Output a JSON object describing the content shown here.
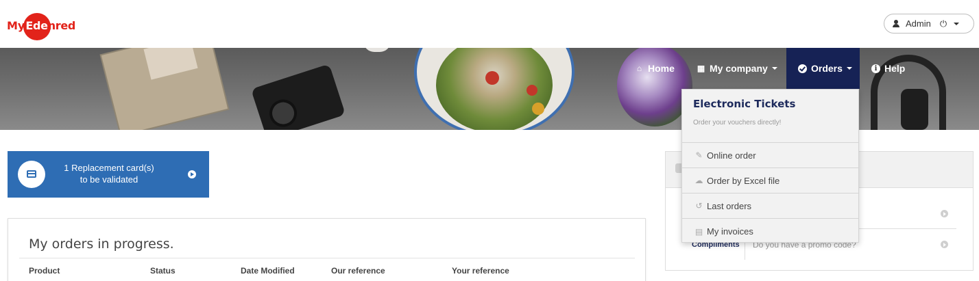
{
  "header": {
    "logo_my": "My",
    "logo_e": "Ede",
    "logo_rest": "nred",
    "admin_label": "Admin",
    "power_icon": "power-icon"
  },
  "nav": {
    "items": [
      {
        "label": "Home",
        "icon": "home-icon"
      },
      {
        "label": "My company",
        "icon": "building-icon"
      },
      {
        "label": "Orders",
        "icon": "check-circle-icon"
      },
      {
        "label": "Help",
        "icon": "info-icon"
      }
    ],
    "active_color": "#162255"
  },
  "orders_menu": {
    "title": "Electronic Tickets",
    "subtitle": "Order your vouchers directly!",
    "items": [
      {
        "label": "Online order",
        "icon": "edit-icon"
      },
      {
        "label": "Order by Excel file",
        "icon": "cloud-upload-icon"
      },
      {
        "label": "Last orders",
        "icon": "history-icon"
      },
      {
        "label": "My invoices",
        "icon": "document-icon"
      }
    ]
  },
  "replacement_card": {
    "line1": "1 Replacement card(s)",
    "line2": "to be validated",
    "color": "#2e6db4"
  },
  "orders_panel": {
    "title": "My orders in progress.",
    "columns": [
      "Product",
      "Status",
      "Date Modified",
      "Our reference",
      "Your reference"
    ]
  },
  "right_panel": {
    "compliments_label": "Compliments",
    "promo_text": "Do you have a promo code?"
  }
}
